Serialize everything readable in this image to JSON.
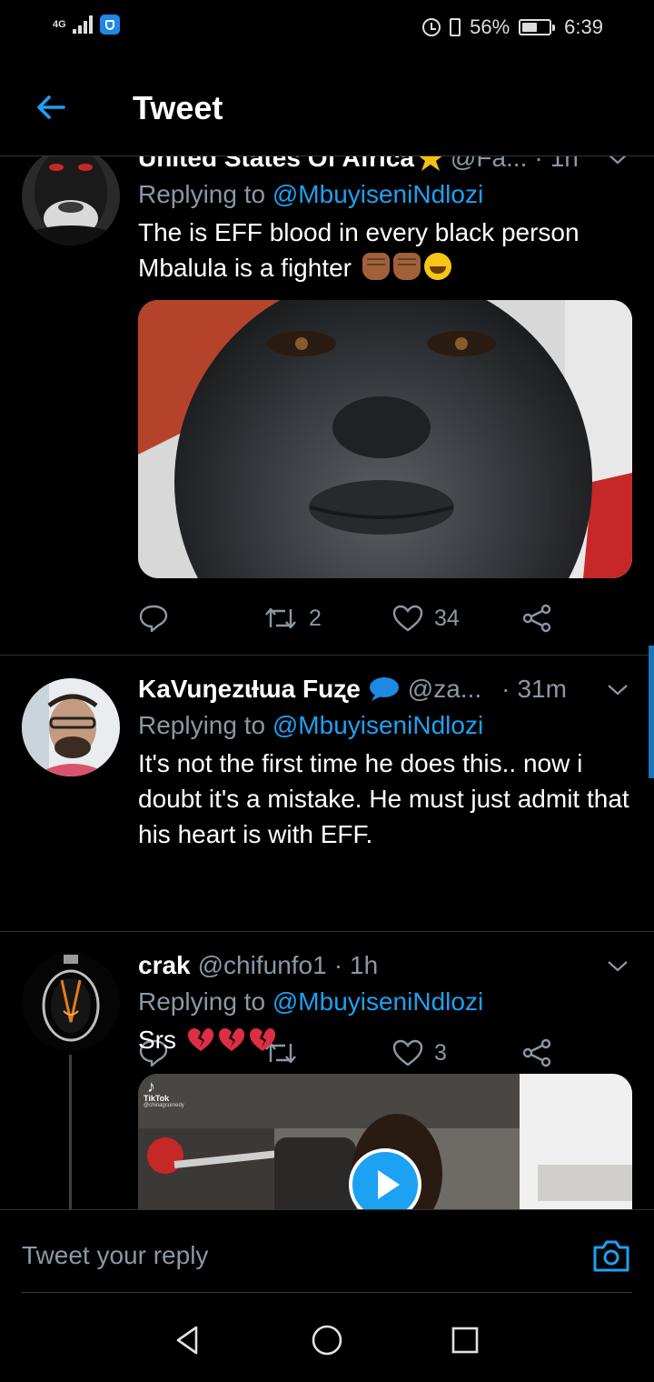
{
  "status_bar": {
    "network": "4G",
    "battery": "56%",
    "battery_level": 0.56,
    "time": "6:39"
  },
  "header": {
    "title": "Tweet",
    "back_icon": "arrow-left-icon"
  },
  "tweets": [
    {
      "name": "United States Of Africa",
      "name_emoji": "star",
      "handle": "@Fa...",
      "dot": "·",
      "time": "1h",
      "replying_prefix": "Replying to ",
      "replying_to": "@MbuyiseniNdlozi",
      "text_line1": "The is EFF blood in every black person",
      "text_line2": "Mbalula is a fighter",
      "emojis": [
        "raised-fist",
        "raised-fist",
        "tears-of-joy"
      ],
      "retweets": "2",
      "likes": "34"
    },
    {
      "name": "KaVuŋezɩƗɯa Fuʐe",
      "name_emoji": "speech-bubble",
      "handle": "@za...",
      "dot": "·",
      "time": "31m",
      "replying_prefix": "Replying to ",
      "replying_to": "@MbuyiseniNdlozi",
      "text": "It's not the first time he does this.. now i doubt it's a mistake. He must just admit that his heart is with EFF.",
      "retweets": "",
      "likes": "3"
    },
    {
      "name": "crak",
      "handle": "@chifunfo1",
      "dot": "·",
      "time": "1h",
      "replying_prefix": "Replying to ",
      "replying_to": "@MbuyiseniNdlozi",
      "text": "Srs",
      "emojis": [
        "broken-heart",
        "broken-heart",
        "broken-heart"
      ],
      "video_watermark": "TikTok",
      "video_sub": "@chinagcomedy"
    }
  ],
  "reply_bar": {
    "placeholder": "Tweet your reply",
    "icon": "camera-icon"
  },
  "nav": [
    "back-triangle-icon",
    "home-circle-icon",
    "recents-square-icon"
  ],
  "colors": {
    "background": "#000000",
    "accent": "#1da1f2",
    "secondary_text": "#8899a6",
    "divider": "#2f3336"
  }
}
